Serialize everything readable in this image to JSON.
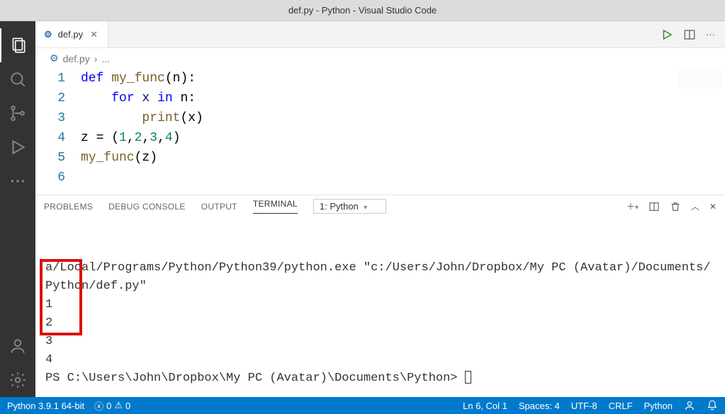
{
  "window": {
    "title": "def.py - Python - Visual Studio Code"
  },
  "tab": {
    "filename": "def.py"
  },
  "breadcrumb": {
    "file": "def.py",
    "sep": "›",
    "more": "..."
  },
  "code": {
    "lines": [
      "1",
      "2",
      "3",
      "4",
      "5",
      "6"
    ],
    "l1_def": "def",
    "l1_fn": "my_func",
    "l1_rest": "(n):",
    "l2_for": "for",
    "l2_mid": " x ",
    "l2_in": "in",
    "l2_rest": " n:",
    "l3_fn": "print",
    "l3_rest": "(x)",
    "l4_a": "z = (",
    "l4_n1": "1",
    "l4_c1": ",",
    "l4_n2": "2",
    "l4_c2": ",",
    "l4_n3": "3",
    "l4_c3": ",",
    "l4_n4": "4",
    "l4_c4": ")",
    "l5_fn": "my_func",
    "l5_rest": "(z)"
  },
  "panel": {
    "tabs": {
      "problems": "PROBLEMS",
      "debug": "DEBUG CONSOLE",
      "output": "OUTPUT",
      "terminal": "TERMINAL"
    },
    "selector": "1: Python"
  },
  "terminal": {
    "line1": "a/Local/Programs/Python/Python39/python.exe \"c:/Users/John/Dropbox/My PC (Avatar)/Documents/Python/def.py\"",
    "out1": "1",
    "out2": "2",
    "out3": "3",
    "out4": "4",
    "prompt": "PS C:\\Users\\John\\Dropbox\\My PC (Avatar)\\Documents\\Python> "
  },
  "status": {
    "python": "Python 3.9.1 64-bit",
    "errors": "0",
    "warnings": "0",
    "lncol": "Ln 6, Col 1",
    "spaces": "Spaces: 4",
    "encoding": "UTF-8",
    "eol": "CRLF",
    "lang": "Python"
  }
}
